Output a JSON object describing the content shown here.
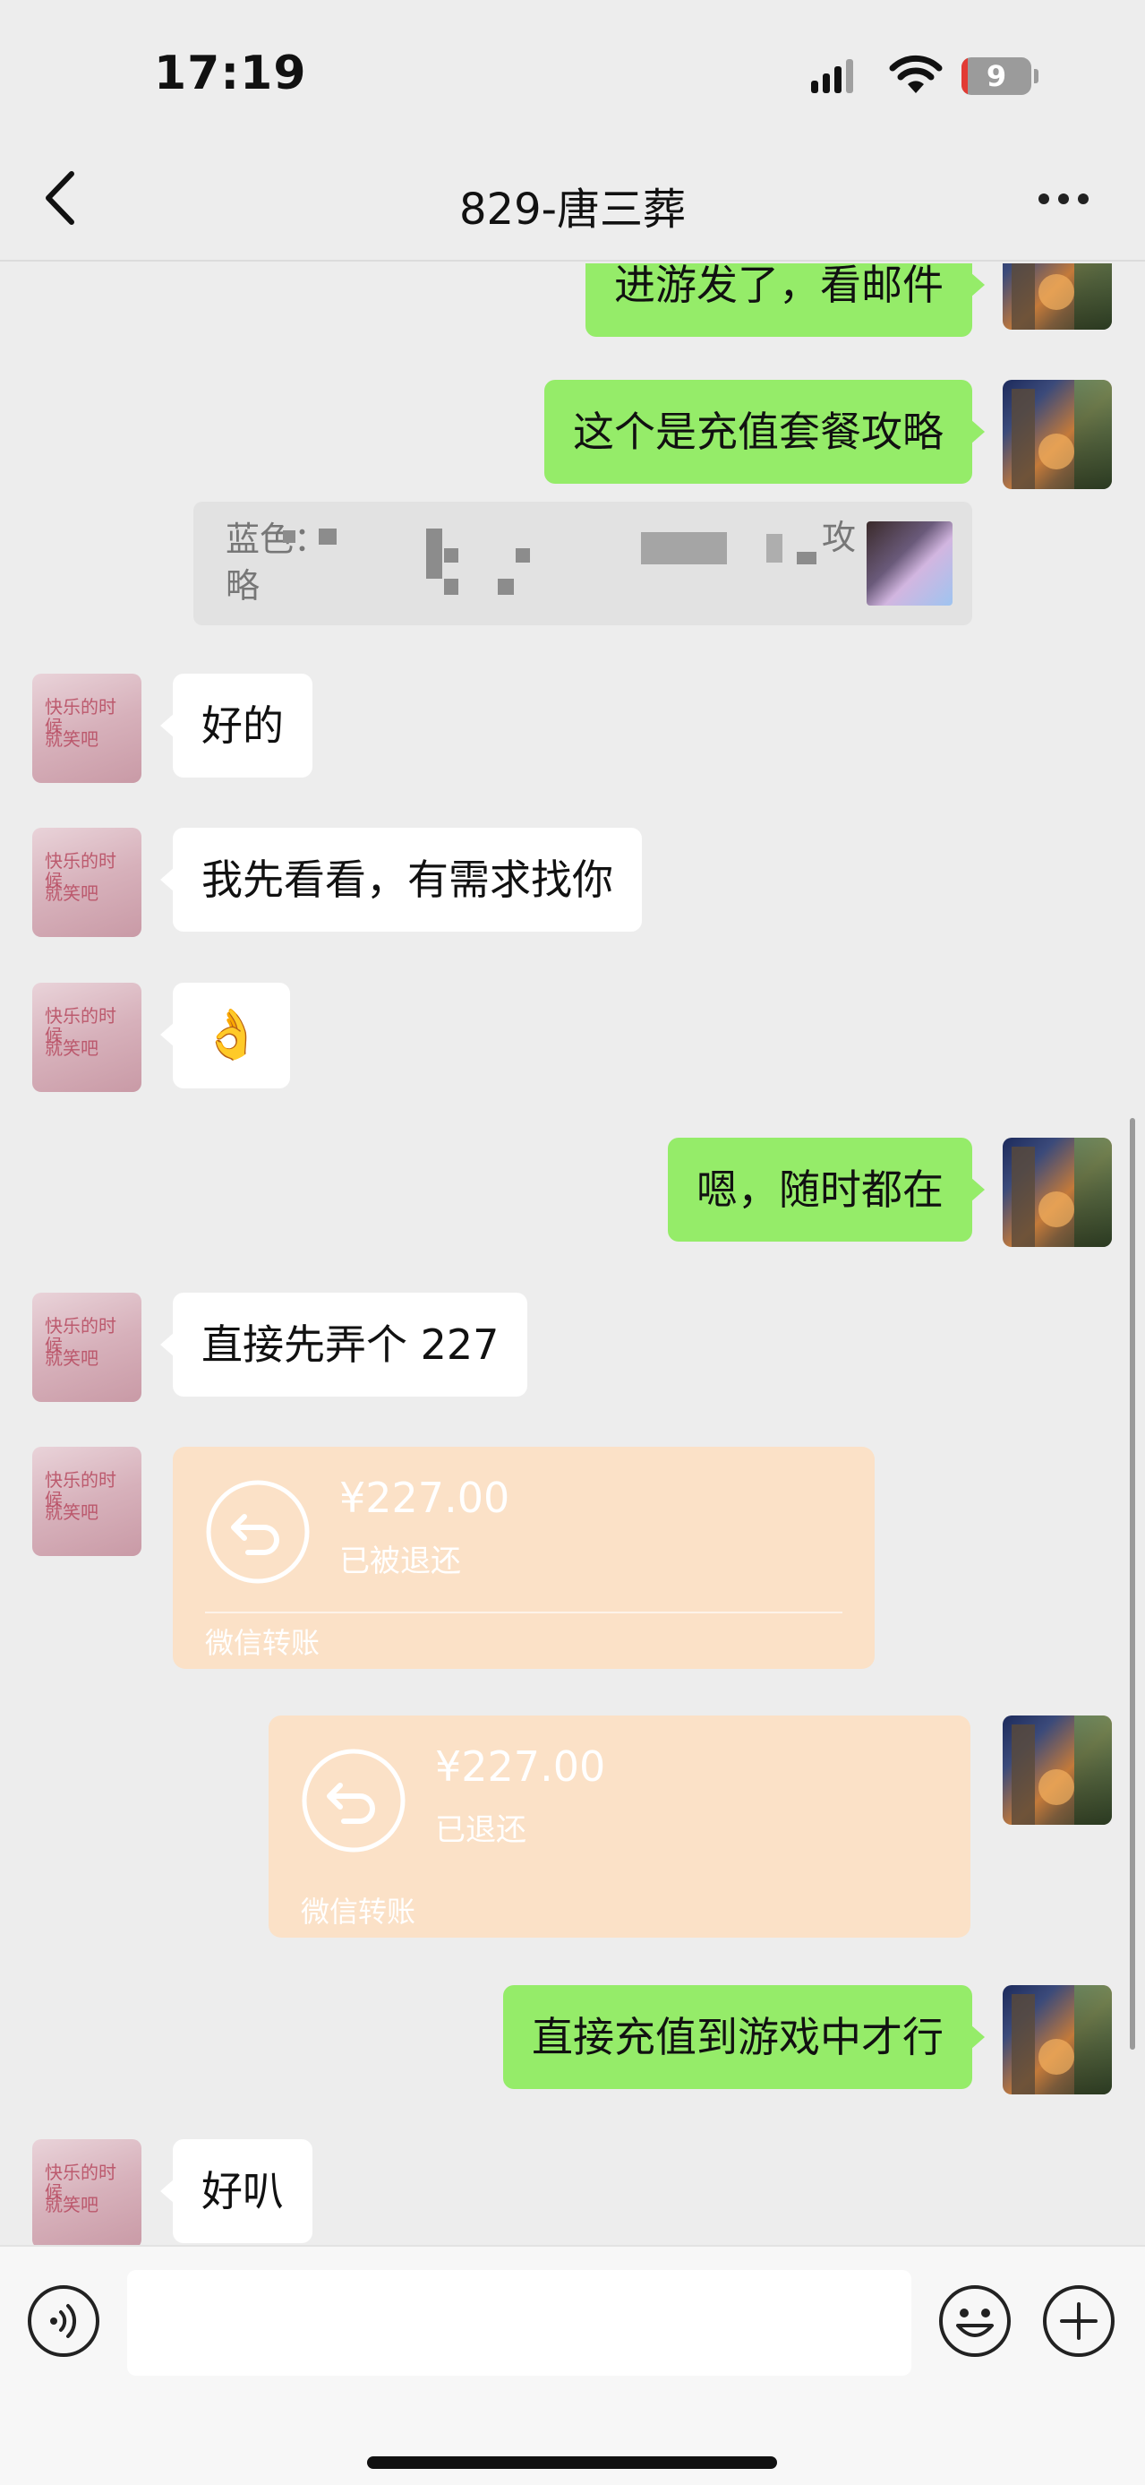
{
  "status_bar": {
    "time": "17:19",
    "battery": "9",
    "battery_level": 0.09
  },
  "header": {
    "title": "829-唐三葬"
  },
  "messages": [
    {
      "from": "self",
      "text": "进游发了，看邮件"
    },
    {
      "from": "self",
      "text": "这个是充值套餐攻略"
    },
    {
      "from": "self",
      "type": "quote",
      "prefix": "蓝色：",
      "line2": "略",
      "tail": "攻"
    },
    {
      "from": "other",
      "text": "好的"
    },
    {
      "from": "other",
      "text": "我先看看，有需求找你"
    },
    {
      "from": "other",
      "type": "emoji",
      "text": "👌"
    },
    {
      "from": "self",
      "text": "嗯，随时都在"
    },
    {
      "from": "other",
      "text": "直接先弄个 227"
    },
    {
      "from": "other",
      "type": "transfer",
      "amount": "¥227.00",
      "status": "已被退还",
      "source": "微信转账"
    },
    {
      "from": "self",
      "type": "transfer",
      "amount": "¥227.00",
      "status": "已退还",
      "source": "微信转账"
    },
    {
      "from": "self",
      "text": "直接充值到游戏中才行"
    },
    {
      "from": "other",
      "text": "好叭"
    }
  ],
  "avatar_other_scribble": {
    "line1": "快乐的时候",
    "line2": "就笑吧"
  },
  "input_bar": {
    "text_value": ""
  },
  "icons": [
    "back-icon",
    "more-icon",
    "voice-icon",
    "emoji-icon",
    "plus-icon",
    "transfer-return-icon"
  ],
  "colors": {
    "self_bubble": "#95ec69",
    "other_bubble": "#ffffff",
    "transfer": "#fbe1c7",
    "background": "#ededed"
  }
}
